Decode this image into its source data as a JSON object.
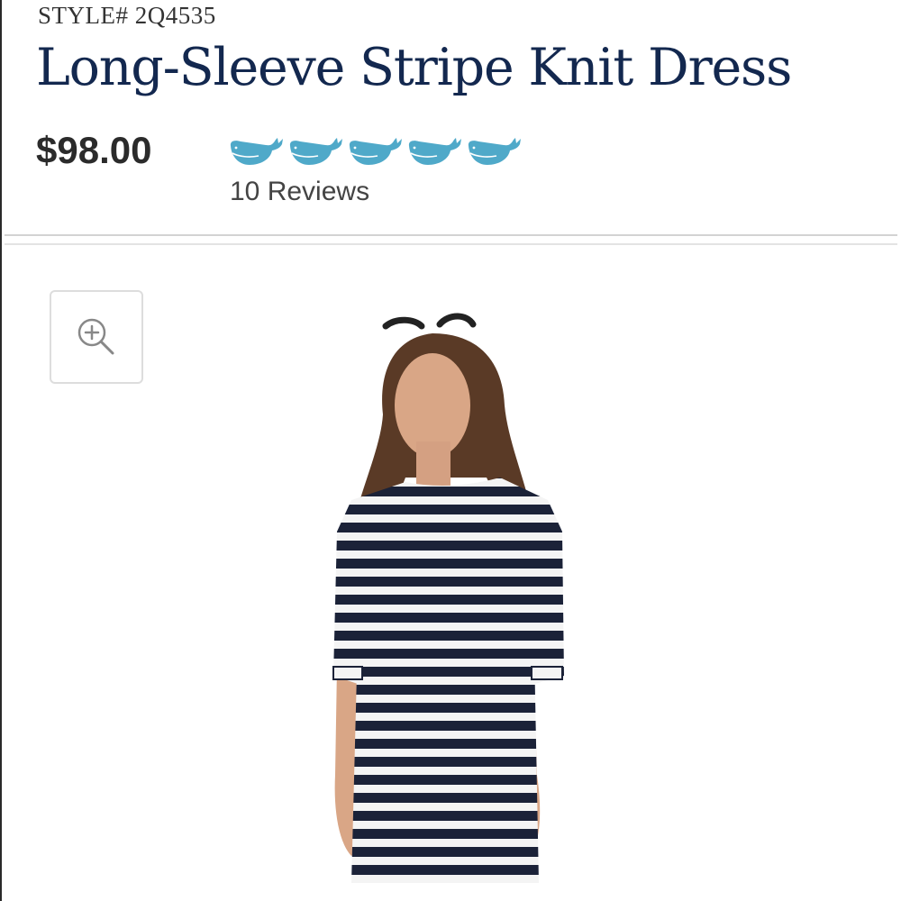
{
  "product": {
    "style_label": "STYLE# 2Q4535",
    "title": "Long-Sleeve Stripe Knit Dress",
    "price": "$98.00",
    "rating": {
      "value": 5,
      "max": 5,
      "icon": "whale-icon",
      "color": "#4fa9c9"
    },
    "reviews_label": "10 Reviews"
  },
  "toolbar": {
    "zoom_icon": "zoom-in-icon"
  },
  "image": {
    "subject": "woman-in-striped-dress-photo"
  },
  "colors": {
    "title": "#13284f",
    "price": "#2b2b2b",
    "accent": "#4fa9c9",
    "stripe": "#1b2238"
  }
}
